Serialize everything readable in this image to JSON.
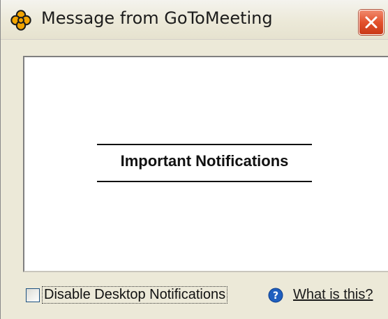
{
  "window": {
    "title": "Message from GoToMeeting",
    "title_icon": "gotomeeting-flower-icon",
    "close_icon": "close-icon"
  },
  "content": {
    "heading": "Important Notifications"
  },
  "footer": {
    "checkbox_label": "Disable Desktop Notifications",
    "checkbox_checked": false,
    "help_icon": "question-circle-icon",
    "help_link": "What is this?"
  },
  "colors": {
    "window_bg": "#ece9d8",
    "close_button": "#e3512c",
    "help_icon": "#1f5fbf",
    "title_icon": "#f2a400"
  }
}
